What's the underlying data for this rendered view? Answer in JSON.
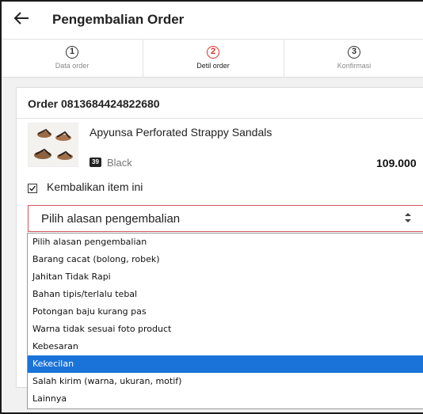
{
  "header": {
    "title": "Pengembalian Order",
    "back_icon": "arrow-left-icon"
  },
  "stepper": {
    "steps": [
      {
        "number": "1",
        "label": "Data order",
        "active": false
      },
      {
        "number": "2",
        "label": "Detil order",
        "active": true
      },
      {
        "number": "3",
        "label": "Konfirmasi",
        "active": false
      }
    ],
    "active_color": "#e0302a"
  },
  "order": {
    "title": "Order 0813684424822680",
    "product": {
      "name": "Apyunsa Perforated Strappy Sandals",
      "size": "39",
      "color": "Black",
      "price": "109.000"
    },
    "return_checkbox_label": "Kembalikan item ini",
    "return_checked": true,
    "reason_select_value": "Pilih alasan pengembalian"
  },
  "dropdown": {
    "options": [
      "Pilih alasan pengembalian",
      "Barang cacat (bolong, robek)",
      "Jahitan Tidak Rapi",
      "Bahan tipis/terlalu tebal",
      "Potongan baju kurang pas",
      "Warna tidak sesuai foto product",
      "Kebesaran",
      "Kekecilan",
      "Salah kirim (warna, ukuran, motif)",
      "Lainnya"
    ],
    "highlighted": "Kekecilan",
    "highlight_color": "#1a73d9"
  }
}
